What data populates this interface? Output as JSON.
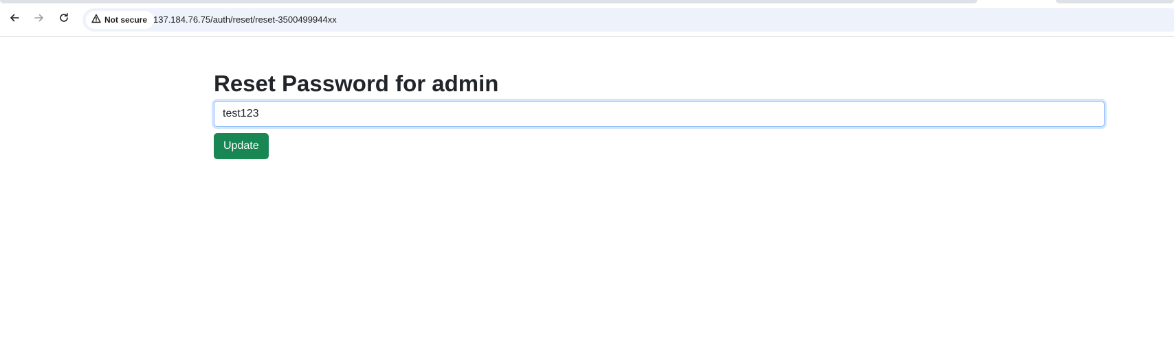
{
  "browser": {
    "back_icon": "arrow-left-icon",
    "forward_icon": "arrow-right-icon",
    "reload_icon": "reload-icon",
    "security_icon": "warning-triangle-icon",
    "security_label": "Not secure",
    "url": "137.184.76.75/auth/reset/reset-3500499944xx"
  },
  "page": {
    "title": "Reset Password for admin",
    "password_value": "test123",
    "update_label": "Update"
  },
  "colors": {
    "button_bg": "#198754",
    "input_focus_border": "#86b7fe",
    "title_text": "#212529"
  }
}
